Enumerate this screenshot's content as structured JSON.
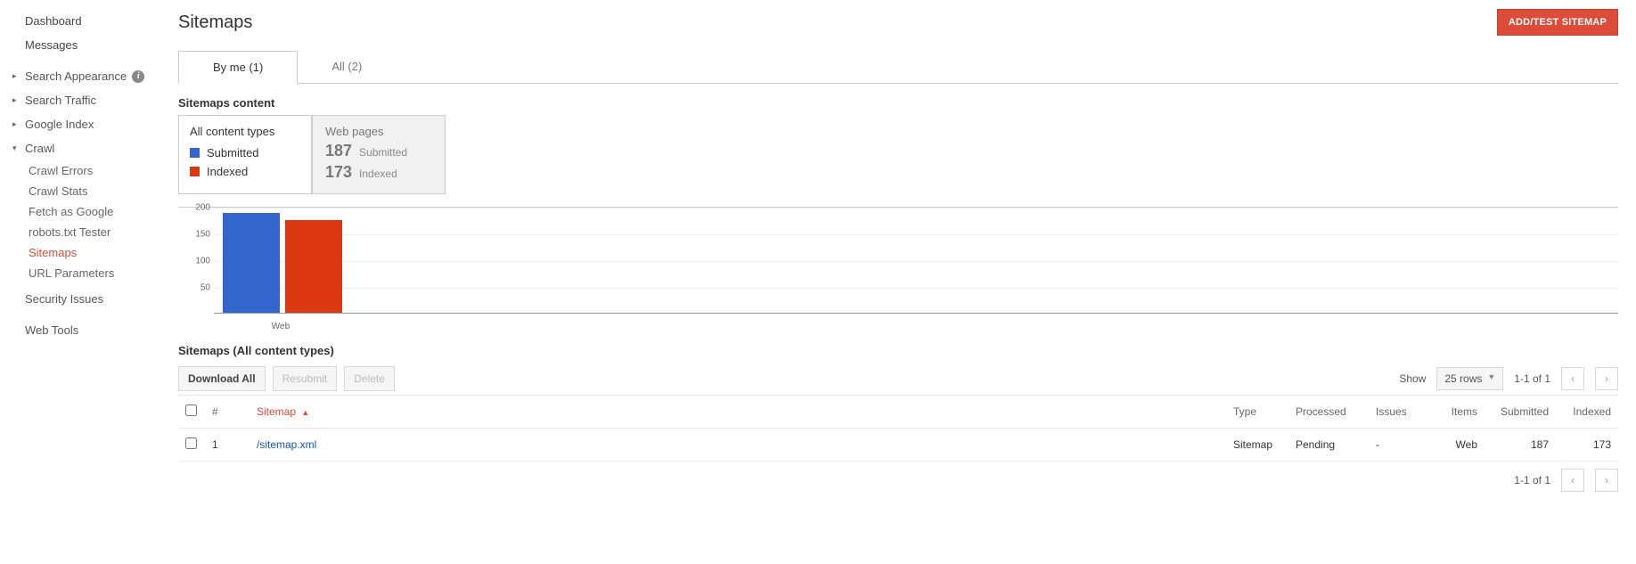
{
  "sidebar": {
    "dashboard": "Dashboard",
    "messages": "Messages",
    "search_appearance": "Search Appearance",
    "search_traffic": "Search Traffic",
    "google_index": "Google Index",
    "crawl": "Crawl",
    "crawl_children": {
      "crawl_errors": "Crawl Errors",
      "crawl_stats": "Crawl Stats",
      "fetch_as_google": "Fetch as Google",
      "robots_tester": "robots.txt Tester",
      "sitemaps": "Sitemaps",
      "url_parameters": "URL Parameters"
    },
    "security_issues": "Security Issues",
    "web_tools": "Web Tools"
  },
  "header": {
    "title": "Sitemaps",
    "add_test_btn": "ADD/TEST SITEMAP"
  },
  "tabs": {
    "by_me": "By me (1)",
    "all": "All (2)"
  },
  "summary": {
    "section_title": "Sitemaps content",
    "legend_title": "All content types",
    "legend_submitted": "Submitted",
    "legend_indexed": "Indexed",
    "stat_title": "Web pages",
    "stat_submitted_value": "187",
    "stat_submitted_label": "Submitted",
    "stat_indexed_value": "173",
    "stat_indexed_label": "Indexed"
  },
  "chart_data": {
    "type": "bar",
    "categories": [
      "Web"
    ],
    "series": [
      {
        "name": "Submitted",
        "color": "#3366cc",
        "values": [
          187
        ]
      },
      {
        "name": "Indexed",
        "color": "#dc3912",
        "values": [
          173
        ]
      }
    ],
    "ylim": [
      0,
      200
    ],
    "yticks": [
      50,
      100,
      150,
      200
    ]
  },
  "table": {
    "section_title": "Sitemaps (All content types)",
    "download_all": "Download All",
    "resubmit": "Resubmit",
    "delete": "Delete",
    "show_label": "Show",
    "rows_select": "25 rows",
    "range_label": "1-1 of 1",
    "headers": {
      "num": "#",
      "sitemap": "Sitemap",
      "type": "Type",
      "processed": "Processed",
      "issues": "Issues",
      "items": "Items",
      "submitted": "Submitted",
      "indexed": "Indexed"
    },
    "rows": [
      {
        "num": "1",
        "sitemap": "/sitemap.xml",
        "type": "Sitemap",
        "processed": "Pending",
        "issues": "-",
        "items": "Web",
        "submitted": "187",
        "indexed": "173"
      }
    ]
  }
}
